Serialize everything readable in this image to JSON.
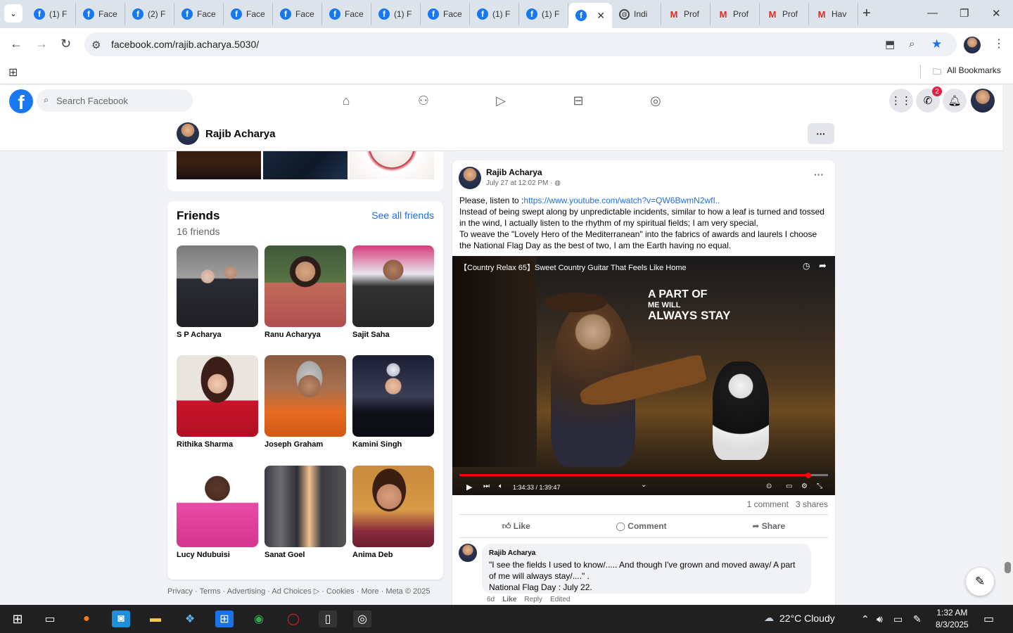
{
  "browser": {
    "tabs": [
      {
        "label": "(1) F",
        "favicon": "facebook-icon"
      },
      {
        "label": "Face",
        "favicon": "facebook-icon"
      },
      {
        "label": "(2) F",
        "favicon": "facebook-icon"
      },
      {
        "label": "Face",
        "favicon": "facebook-icon"
      },
      {
        "label": "Face",
        "favicon": "facebook-icon"
      },
      {
        "label": "Face",
        "favicon": "facebook-icon"
      },
      {
        "label": "Face",
        "favicon": "facebook-icon"
      },
      {
        "label": "(1) F",
        "favicon": "facebook-icon"
      },
      {
        "label": "Face",
        "favicon": "facebook-icon"
      },
      {
        "label": "(1) F",
        "favicon": "facebook-icon"
      },
      {
        "label": "(1) F",
        "favicon": "facebook-icon"
      },
      {
        "label": "",
        "favicon": "facebook-icon",
        "active": true
      },
      {
        "label": "Indi",
        "favicon": "globe-icon"
      },
      {
        "label": "Prof",
        "favicon": "gmail-icon"
      },
      {
        "label": "Prof",
        "favicon": "gmail-icon"
      },
      {
        "label": "Prof",
        "favicon": "gmail-icon"
      },
      {
        "label": "Hav",
        "favicon": "gmail-icon"
      }
    ],
    "url": "facebook.com/rajib.acharya.5030/",
    "bookmarks_label": "All Bookmarks"
  },
  "fb": {
    "search_placeholder": "Search Facebook",
    "notification_count": "2",
    "brand_color": "#1877f2"
  },
  "profile": {
    "name": "Rajib Acharya"
  },
  "friends": {
    "title": "Friends",
    "count": "16 friends",
    "see_all": "See all friends",
    "list": [
      {
        "name": "S P Acharya"
      },
      {
        "name": "Ranu Acharyya"
      },
      {
        "name": "Sajit Saha"
      },
      {
        "name": "Rithika Sharma"
      },
      {
        "name": "Joseph Graham"
      },
      {
        "name": "Kamini Singh"
      },
      {
        "name": "Lucy Ndubuisi"
      },
      {
        "name": "Sanat Goel"
      },
      {
        "name": "Anima Deb"
      }
    ]
  },
  "footer": {
    "privacy": "Privacy",
    "terms": "Terms",
    "advertising": "Advertising",
    "ad_choices": "Ad Choices",
    "cookies": "Cookies",
    "more": "More",
    "meta": "Meta © 2025"
  },
  "post": {
    "author": "Rajib Acharya",
    "time": "July 27 at 12:02 PM ·",
    "text_prefix": "Please, listen to :",
    "link": "https://www.youtube.com/watch?v=QW6BwmN2wfI..",
    "text_lines": [
      "Instead of being swept along by unpredictable incidents, similar to how a leaf is turned and tossed in the wind, I actually listen to the rhythm of my spiritual fields; I am very special,",
      "To weave the \"Lovely Hero of the Mediterranean\" into the fabrics of awards and laurels I choose the National  Flag Day as the best of two, I am the Earth having no equal."
    ],
    "video": {
      "title": "【Country Relax 65】Sweet Country Guitar That Feels Like Home",
      "overlay_line1": "A PART OF",
      "overlay_line2": "ME WILL",
      "overlay_line3": "ALWAYS STAY",
      "time": "1:34:33 / 1:39:47",
      "progress": 0.947
    },
    "comments_count": "1 comment",
    "shares_count": "3 shares",
    "like_label": "Like",
    "comment_label": "Comment",
    "share_label": "Share",
    "comment": {
      "author": "Rajib Acharya",
      "text_line1": "\"I see the fields I used to know/..... And though I've grown and moved away/ A part of me will always stay/....\" .",
      "text_line2": "National Flag Day : July 22.",
      "age": "6d",
      "like": "Like",
      "reply": "Reply",
      "edited": "Edited"
    }
  },
  "taskbar": {
    "weather": "22°C  Cloudy",
    "time": "1:32 AM",
    "date": "8/3/2025"
  }
}
